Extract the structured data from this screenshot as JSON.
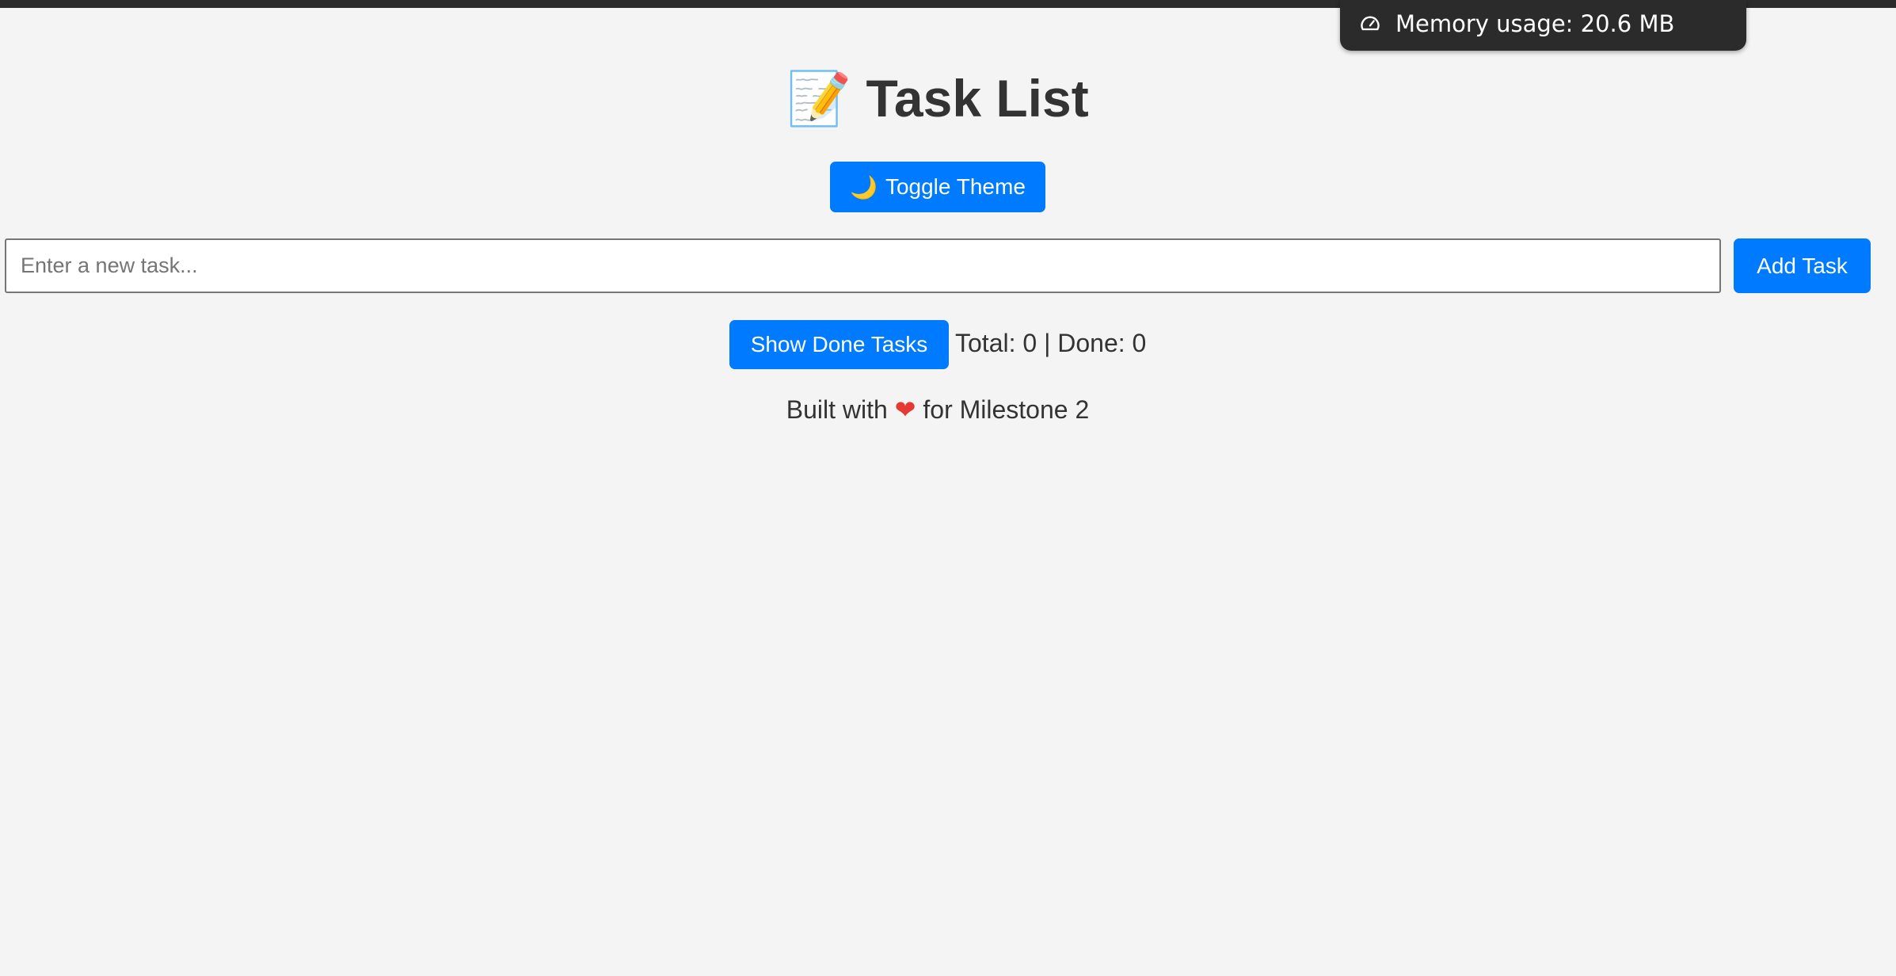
{
  "toast": {
    "icon": "gauge-icon",
    "text": "Memory usage: 20.6 MB"
  },
  "header": {
    "title_emoji": "📝",
    "title": "Task List"
  },
  "theme_toggle": {
    "icon": "🌙",
    "label": "Toggle Theme"
  },
  "task_input": {
    "placeholder": "Enter a new task...",
    "value": ""
  },
  "add_button": {
    "label": "Add Task"
  },
  "show_done_button": {
    "label": "Show Done Tasks"
  },
  "stats": {
    "text": "Total: 0 | Done: 0"
  },
  "footer": {
    "prefix": "Built with",
    "heart": "❤",
    "suffix": "for Milestone 2"
  },
  "colors": {
    "accent": "#007bff",
    "background": "#f4f4f4",
    "text": "#333333",
    "toast_bg": "#2b2b2b"
  }
}
